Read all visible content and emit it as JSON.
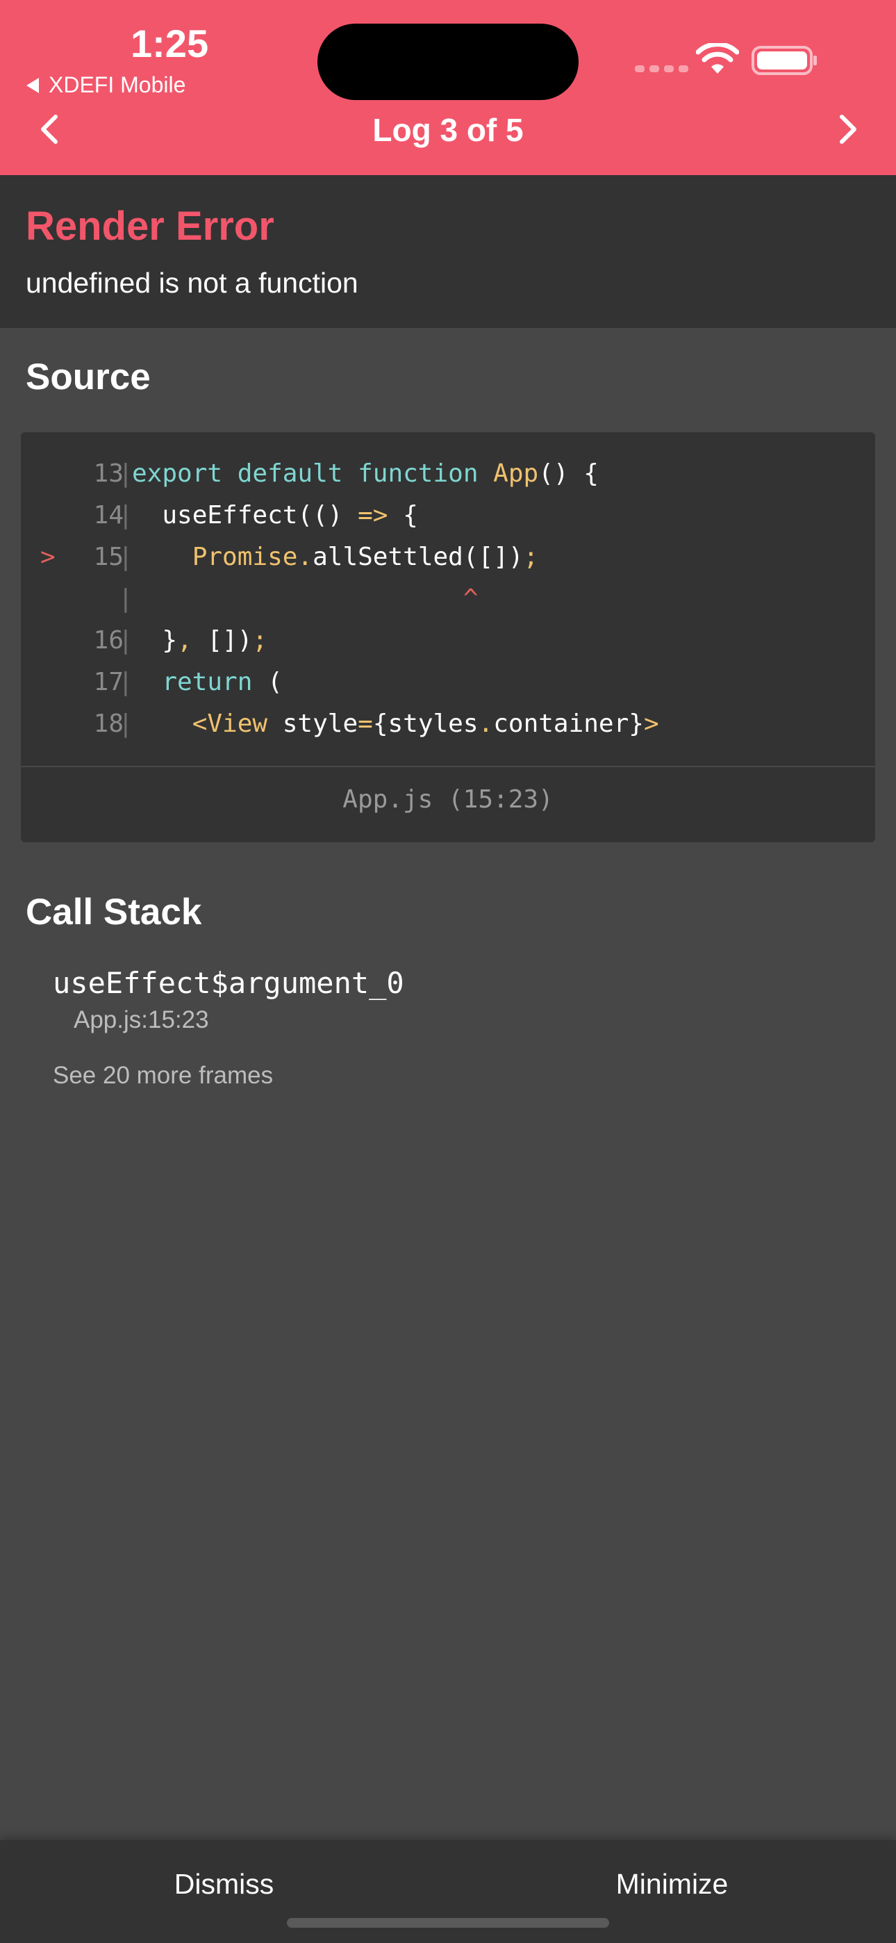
{
  "status_bar": {
    "time": "1:25",
    "back_app": "XDEFI Mobile"
  },
  "nav": {
    "title": "Log 3 of 5"
  },
  "error": {
    "title": "Render Error",
    "message": "undefined is not a function"
  },
  "source": {
    "heading": "Source",
    "lines": [
      {
        "marker": "",
        "num": "13",
        "tokens": [
          [
            "kw",
            "export default function "
          ],
          [
            "fn",
            "App"
          ],
          [
            "punc",
            "() {"
          ]
        ]
      },
      {
        "marker": "",
        "num": "14",
        "tokens": [
          [
            "punc",
            "  useEffect(() "
          ],
          [
            "op",
            "=>"
          ],
          [
            "punc",
            " {"
          ]
        ]
      },
      {
        "marker": ">",
        "num": "15",
        "tokens": [
          [
            "fn",
            "    Promise"
          ],
          [
            "op",
            "."
          ],
          [
            "punc",
            "allSettled([])"
          ],
          [
            "op",
            ";"
          ]
        ]
      },
      {
        "marker": "",
        "num": "",
        "tokens": [
          [
            "err",
            "                      ^"
          ]
        ]
      },
      {
        "marker": "",
        "num": "16",
        "tokens": [
          [
            "punc",
            "  }"
          ],
          [
            "op",
            ","
          ],
          [
            "punc",
            " [])"
          ],
          [
            "op",
            ";"
          ]
        ]
      },
      {
        "marker": "",
        "num": "17",
        "tokens": [
          [
            "kw",
            "  return"
          ],
          [
            "punc",
            " ("
          ]
        ]
      },
      {
        "marker": "",
        "num": "18",
        "tokens": [
          [
            "fn",
            "    <View"
          ],
          [
            "punc",
            " style"
          ],
          [
            "op",
            "="
          ],
          [
            "punc",
            "{styles"
          ],
          [
            "op",
            "."
          ],
          [
            "punc",
            "container}"
          ],
          [
            "fn",
            ">"
          ]
        ]
      }
    ],
    "file": "App.js (15:23)"
  },
  "call_stack": {
    "heading": "Call Stack",
    "frame_name": "useEffect$argument_0",
    "frame_location": "App.js:15:23",
    "more_frames": "See 20 more frames"
  },
  "bottom_bar": {
    "dismiss": "Dismiss",
    "minimize": "Minimize"
  },
  "colors": {
    "accent": "#f2566b",
    "background": "#474747",
    "panel": "#333333"
  }
}
